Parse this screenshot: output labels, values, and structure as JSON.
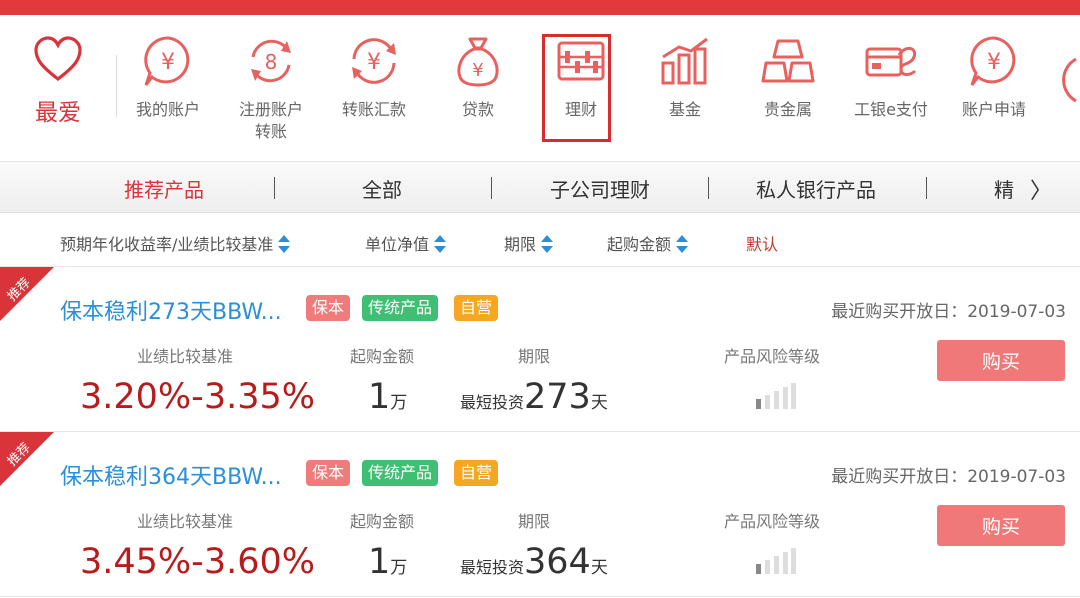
{
  "colors": {
    "accent": "#d8343a",
    "link": "#2a8fd8",
    "rate": "#b71c1c",
    "buy": "#f07878",
    "tag_red": "#ef7b7b",
    "tag_green": "#3fbf73",
    "tag_orange": "#f5a623"
  },
  "favorite": {
    "label": "最爱",
    "icon": "heart-icon"
  },
  "nav": [
    {
      "label": "我的账户",
      "icon": "yen-bubble-icon"
    },
    {
      "label": "注册账户\n转账",
      "icon": "yen-cycle-icon"
    },
    {
      "label": "转账汇款",
      "icon": "transfer-yen-icon"
    },
    {
      "label": "贷款",
      "icon": "money-bag-icon"
    },
    {
      "label": "理财",
      "icon": "abacus-icon",
      "selected": true
    },
    {
      "label": "基金",
      "icon": "bar-chart-icon"
    },
    {
      "label": "贵金属",
      "icon": "gold-bars-icon"
    },
    {
      "label": "工银e支付",
      "icon": "card-pay-icon"
    },
    {
      "label": "账户申请",
      "icon": "yen-bubble-icon"
    }
  ],
  "tabs": [
    "推荐产品",
    "全部",
    "子公司理财",
    "私人银行产品",
    "精"
  ],
  "tab_arrow": "〉",
  "sort": [
    "预期年化收益率/业绩比较基准",
    "单位净值",
    "期限",
    "起购金额",
    "默认"
  ],
  "products": [
    {
      "ribbon": "推荐",
      "name": "保本稳利273天BBW...",
      "tags": [
        "保本",
        "传统产品",
        "自营"
      ],
      "open_date": "最近购买开放日：2019-07-03",
      "h_rate": "业绩比较基准",
      "h_min": "起购金额",
      "h_term": "期限",
      "h_risk": "产品风险等级",
      "rate": "3.20%-3.35%",
      "min_amount": "1",
      "min_unit": "万",
      "term_prefix": "最短投资",
      "term_days": "273",
      "term_unit": "天",
      "risk_level": 1,
      "buy": "购买"
    },
    {
      "ribbon": "推荐",
      "name": "保本稳利364天BBW...",
      "tags": [
        "保本",
        "传统产品",
        "自营"
      ],
      "open_date": "最近购买开放日：2019-07-03",
      "h_rate": "业绩比较基准",
      "h_min": "起购金额",
      "h_term": "期限",
      "h_risk": "产品风险等级",
      "rate": "3.45%-3.60%",
      "min_amount": "1",
      "min_unit": "万",
      "term_prefix": "最短投资",
      "term_days": "364",
      "term_unit": "天",
      "risk_level": 1,
      "buy": "购买"
    }
  ]
}
